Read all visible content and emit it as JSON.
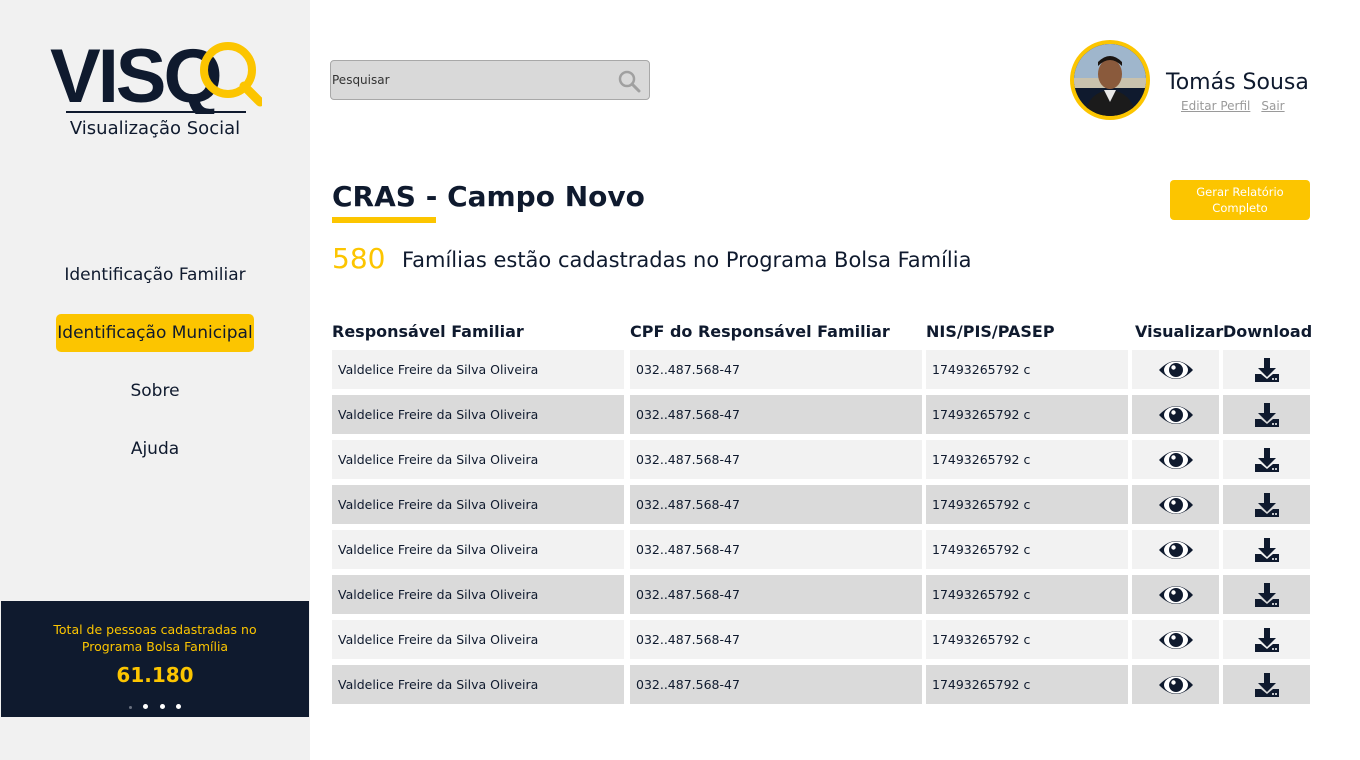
{
  "brand": {
    "logo_text": "VISQ",
    "subtitle": "Visualização Social"
  },
  "nav": {
    "items": [
      {
        "label": "Identificação Familiar",
        "active": false
      },
      {
        "label": "Identificação Municipal",
        "active": true
      },
      {
        "label": "Sobre",
        "active": false
      },
      {
        "label": "Ajuda",
        "active": false
      }
    ]
  },
  "stats": {
    "label": "Total de pessoas cadastradas no Programa Bolsa Família",
    "value": "61.180",
    "carousel_total": 4,
    "carousel_current": 1
  },
  "search": {
    "placeholder": "Pesquisar",
    "icon": "search-icon"
  },
  "user": {
    "name": "Tomás Sousa",
    "edit_profile": "Editar Perfil",
    "logout": "Sair"
  },
  "page": {
    "title": "CRAS - Campo Novo",
    "report_button": "Gerar Relatório Completo",
    "families_count": "580",
    "families_text": "Famílias estão cadastradas no Programa Bolsa Família"
  },
  "table": {
    "headers": {
      "name": "Responsável Familiar",
      "cpf": "CPF do Responsável Familiar",
      "nis": "NIS/PIS/PASEP",
      "view": "Visualizar",
      "download": "Download"
    },
    "rows": [
      {
        "name": "Valdelice Freire da Silva Oliveira",
        "cpf": "032..487.568-47",
        "nis": "17493265792 c"
      },
      {
        "name": "Valdelice Freire da Silva Oliveira",
        "cpf": "032..487.568-47",
        "nis": "17493265792 c"
      },
      {
        "name": "Valdelice Freire da Silva Oliveira",
        "cpf": "032..487.568-47",
        "nis": "17493265792 c"
      },
      {
        "name": "Valdelice Freire da Silva Oliveira",
        "cpf": "032..487.568-47",
        "nis": "17493265792 c"
      },
      {
        "name": "Valdelice Freire da Silva Oliveira",
        "cpf": "032..487.568-47",
        "nis": "17493265792 c"
      },
      {
        "name": "Valdelice Freire da Silva Oliveira",
        "cpf": "032..487.568-47",
        "nis": "17493265792 c"
      },
      {
        "name": "Valdelice Freire da Silva Oliveira",
        "cpf": "032..487.568-47",
        "nis": "17493265792 c"
      },
      {
        "name": "Valdelice Freire da Silva Oliveira",
        "cpf": "032..487.568-47",
        "nis": "17493265792 c"
      }
    ]
  },
  "colors": {
    "accent": "#fcc500",
    "navy": "#0f1a2e",
    "sidebar_bg": "#f1f1f1",
    "row_light": "#f2f2f2",
    "row_dark": "#dadada"
  }
}
